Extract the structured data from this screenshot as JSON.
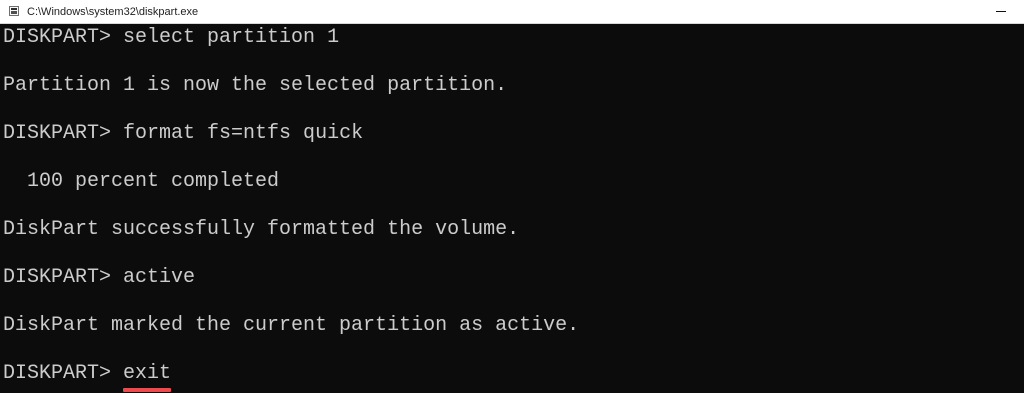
{
  "window": {
    "title": "C:\\Windows\\system32\\diskpart.exe"
  },
  "console": {
    "lines": [
      {
        "prompt": "DISKPART> ",
        "text": "select partition 1"
      },
      {
        "text": "Partition 1 is now the selected partition."
      },
      {
        "prompt": "DISKPART> ",
        "text": "format fs=ntfs quick"
      },
      {
        "text": "  100 percent completed"
      },
      {
        "text": "DiskPart successfully formatted the volume."
      },
      {
        "prompt": "DISKPART> ",
        "text": "active"
      },
      {
        "text": "DiskPart marked the current partition as active."
      },
      {
        "prompt": "DISKPART> ",
        "text": "exit"
      }
    ]
  },
  "colors": {
    "console_background": "#0c0c0c",
    "console_text": "#cccccc",
    "highlight_underline": "#ef4b4f",
    "titlebar_background": "#ffffff"
  },
  "icons": {
    "app_icon": "console-icon",
    "minimize": "minimize-icon"
  }
}
